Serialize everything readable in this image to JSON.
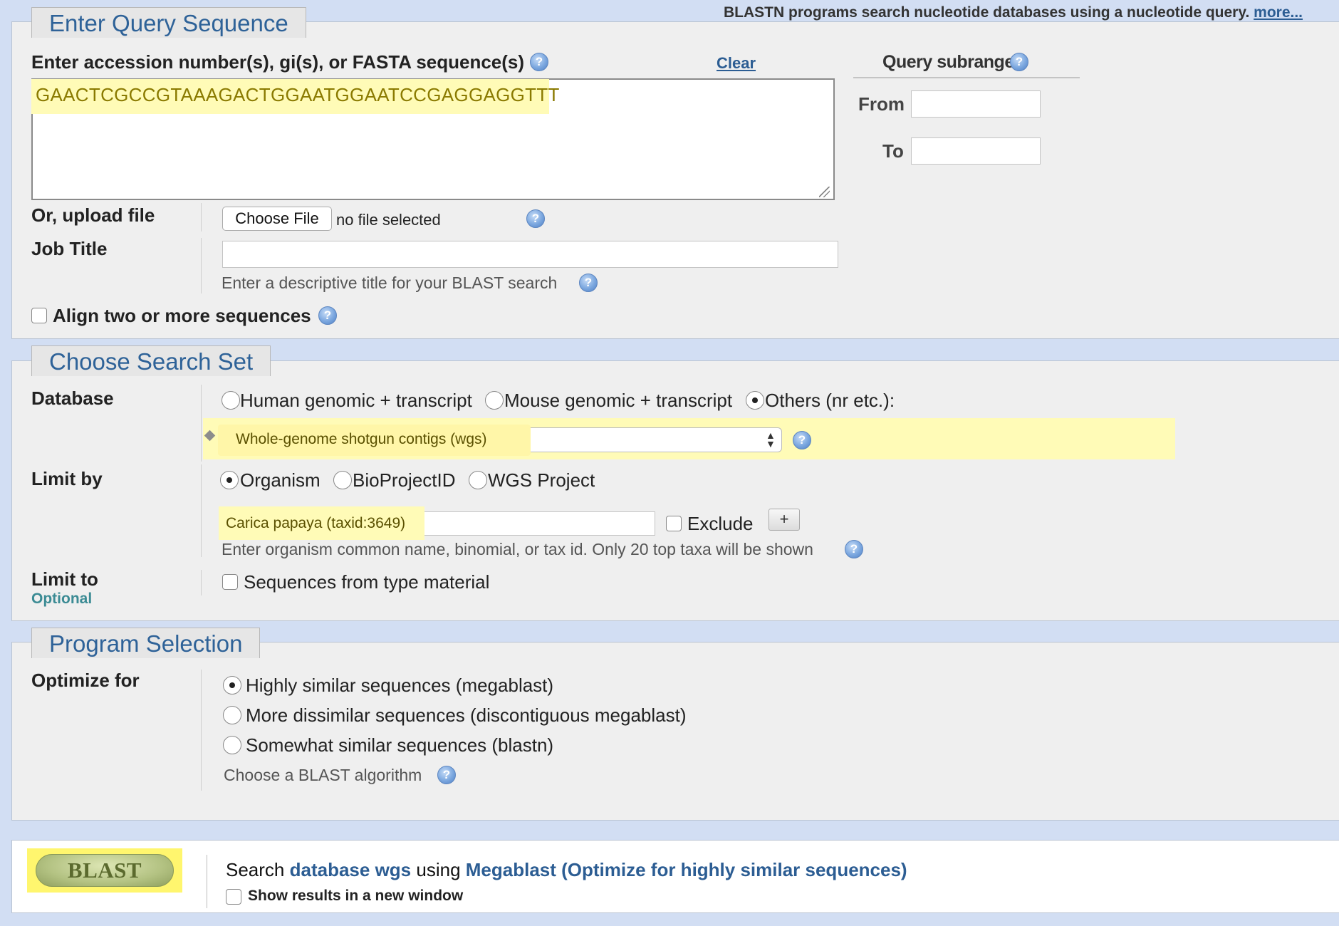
{
  "query": {
    "tab_title": "Enter Query Sequence",
    "program_note": "BLASTN programs search nucleotide databases using a nucleotide query.",
    "program_note_more": "more...",
    "sequence_label": "Enter accession number(s), gi(s), or FASTA sequence(s)",
    "clear_label": "Clear",
    "sequence_value": "GAACTCGCCGTAAAGACTGGAATGGAATCCGAGGAGGTTT",
    "subrange_title": "Query subrange",
    "from_label": "From",
    "to_label": "To",
    "upload_label": "Or, upload file",
    "choose_file_label": "Choose File",
    "no_file_text": "no file selected",
    "job_title_label": "Job Title",
    "job_title_hint": "Enter a descriptive title for your BLAST search",
    "align_label": "Align two or more sequences"
  },
  "search_set": {
    "tab_title": "Choose Search Set",
    "database_label": "Database",
    "db_options": [
      "Human genomic + transcript",
      "Mouse genomic + transcript",
      "Others (nr etc.):"
    ],
    "db_selected": "Others (nr etc.):",
    "db_select_value": "Whole-genome shotgun contigs (wgs)",
    "limit_by_label": "Limit by",
    "limit_options": [
      "Organism",
      "BioProjectID",
      "WGS Project"
    ],
    "limit_selected": "Organism",
    "organism_value": "Carica papaya (taxid:3649)",
    "exclude_label": "Exclude",
    "add_label": "+",
    "organism_hint": "Enter organism common name, binomial, or tax id. Only 20 top taxa will be shown",
    "limit_to_label": "Limit to",
    "optional_label": "Optional",
    "type_material_label": "Sequences from type material"
  },
  "program": {
    "tab_title": "Program Selection",
    "optimize_label": "Optimize for",
    "options": [
      "Highly similar sequences (megablast)",
      "More dissimilar sequences (discontiguous megablast)",
      "Somewhat similar sequences (blastn)"
    ],
    "selected": "Highly similar sequences (megablast)",
    "algorithm_hint": "Choose a BLAST algorithm"
  },
  "submit": {
    "blast_label": "BLAST",
    "summary_prefix": "Search",
    "summary_db": "database wgs",
    "summary_mid": "using",
    "summary_program": "Megablast (Optimize for highly similar sequences)",
    "new_window_label": "Show results in a new window"
  },
  "icons": [
    "help-icon",
    "resize-grip-icon",
    "select-arrows-icon",
    "drag-handle-icon"
  ],
  "colors": {
    "link": "#2c5d93",
    "highlight": "#fffbb7",
    "tab_text": "#2e6298",
    "page_bg": "#d2def3"
  }
}
